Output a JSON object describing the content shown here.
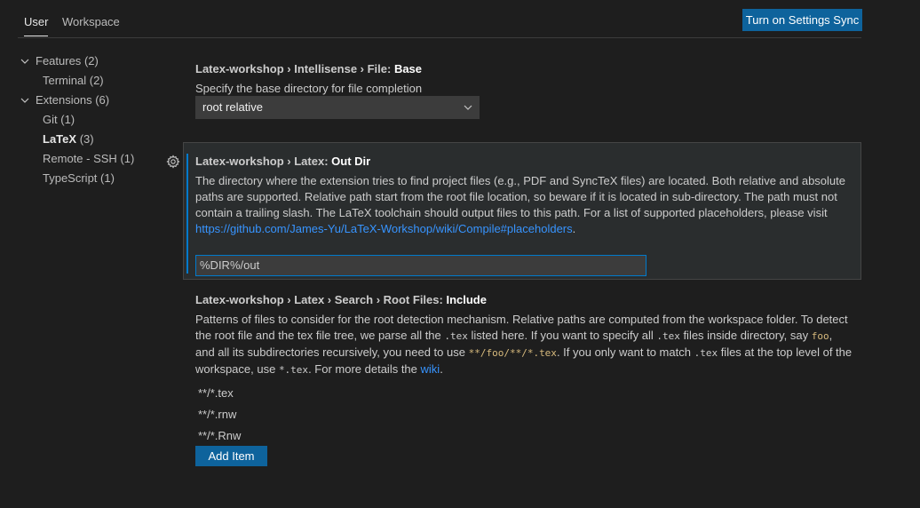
{
  "tabs": {
    "user": "User",
    "workspace": "Workspace"
  },
  "sync_button": "Turn on Settings Sync",
  "tree": {
    "features": {
      "label": "Features",
      "count": "(2)",
      "icon": "chevron-down-icon"
    },
    "terminal": {
      "label": "Terminal",
      "count": "(2)"
    },
    "extensions": {
      "label": "Extensions",
      "count": "(6)",
      "icon": "chevron-down-icon"
    },
    "git": {
      "label": "Git",
      "count": "(1)"
    },
    "latex": {
      "label": "LaTeX",
      "count": "(3)"
    },
    "remote_ssh": {
      "label": "Remote - SSH",
      "count": "(1)"
    },
    "typescript": {
      "label": "TypeScript",
      "count": "(1)"
    }
  },
  "settings": {
    "base": {
      "prefix": "Latex-workshop › Intellisense › File: ",
      "leaf": "Base",
      "description": "Specify the base directory for file completion",
      "value": "root relative"
    },
    "outdir": {
      "prefix": "Latex-workshop › Latex: ",
      "leaf": "Out Dir",
      "description": "The directory where the extension tries to find project files (e.g., PDF and SyncTeX files) are located. Both relative and absolute paths are supported. Relative path start from the root file location, so beware if it is located in sub-directory. The path must not contain a trailing slash. The LaTeX toolchain should output files to this path. For a list of supported placeholders, please visit ",
      "link": "https://github.com/James-Yu/LaTeX-Workshop/wiki/Compile#placeholders",
      "description_end": ".",
      "value": "%DIR%/out",
      "gear_icon": "gear-icon"
    },
    "rootfiles": {
      "prefix": "Latex-workshop › Latex › Search › Root Files: ",
      "leaf": "Include",
      "desc": {
        "t1": "Patterns of files to consider for the root detection mechanism. Relative paths are computed from the workspace folder. To detect the root file and the tex file tree, we parse all the ",
        "c1": ".tex",
        "t2": " listed here. If you want to specify all ",
        "c2": ".tex",
        "t3": " files inside directory, say ",
        "c3": "foo",
        "t4": ", and all its subdirectories recursively, you need to use ",
        "c4": "**/foo/**/*.tex",
        "t5": ". If you only want to match ",
        "c5": ".tex",
        "t6": " files at the top level of the workspace, use ",
        "c6": "*.tex",
        "t7": ". For more details the ",
        "link": "wiki",
        "t8": "."
      },
      "items": [
        "**/*.tex",
        "**/*.rnw",
        "**/*.Rnw"
      ],
      "add_button": "Add Item"
    }
  },
  "colors": {
    "background": "#1e1e1e",
    "accent": "#007acc",
    "button": "#0e639c",
    "link": "#3794ff",
    "code": "#d7ba7d"
  }
}
